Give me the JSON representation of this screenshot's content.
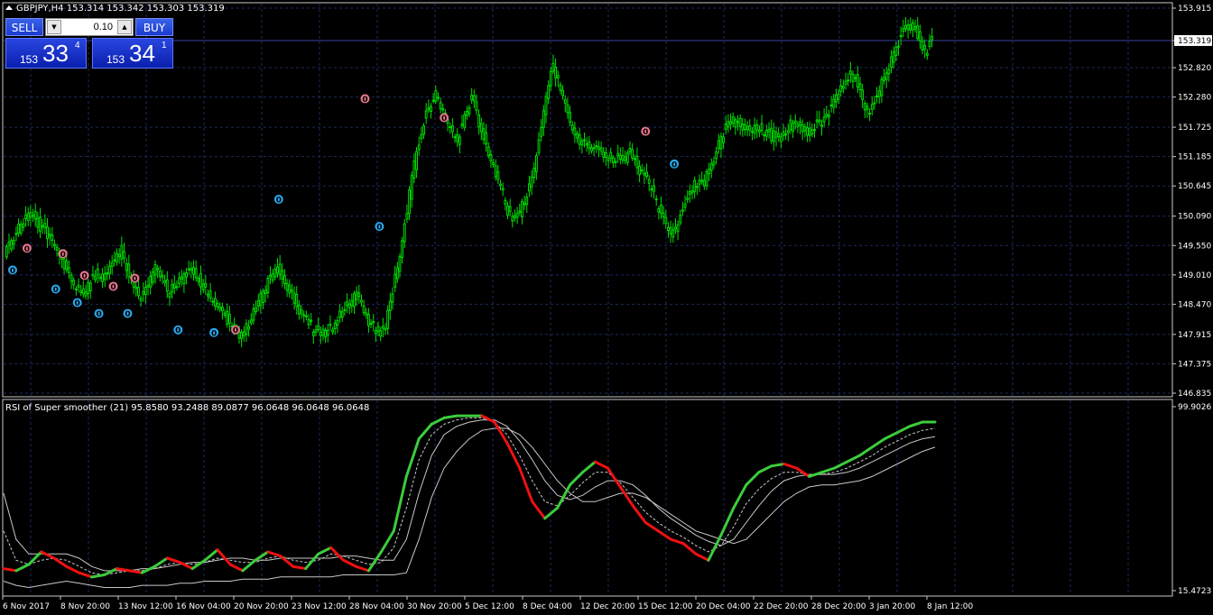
{
  "header": {
    "symbol_line": "GBPJPY,H4  153.314 153.342 153.303 153.319"
  },
  "trade_panel": {
    "sell_label": "SELL",
    "buy_label": "BUY",
    "lot_value": "0.10",
    "sell_price": {
      "prefix": "153",
      "big": "33",
      "sup": "4"
    },
    "buy_price": {
      "prefix": "153",
      "big": "34",
      "sup": "1"
    }
  },
  "indicator": {
    "label": "RSI of Super smoother (21) 95.8580 93.2488 89.0877 96.0648 96.0648 96.0648"
  },
  "price_axis": {
    "ticks": [
      "153.915",
      "153.319",
      "152.820",
      "152.280",
      "151.725",
      "151.185",
      "150.645",
      "150.090",
      "149.550",
      "149.010",
      "148.470",
      "147.915",
      "147.375",
      "146.835"
    ],
    "current_price": "153.319"
  },
  "indicator_axis": {
    "top": "99.9026",
    "bottom": "15.4723"
  },
  "time_axis": {
    "ticks": [
      "6 Nov 2017",
      "8 Nov 20:00",
      "13 Nov 12:00",
      "16 Nov 04:00",
      "20 Nov 20:00",
      "23 Nov 12:00",
      "28 Nov 04:00",
      "30 Nov 20:00",
      "5 Dec 12:00",
      "8 Dec 04:00",
      "12 Dec 20:00",
      "15 Dec 12:00",
      "20 Dec 04:00",
      "22 Dec 20:00",
      "28 Dec 20:00",
      "3 Jan 20:00",
      "8 Jan 12:00"
    ]
  },
  "colors": {
    "background": "#000000",
    "candles": "#00e000",
    "grid": "#1d2a5e",
    "axis_text": "#ffffff",
    "current_price_line": "#3a3fa0",
    "rsi_up": "#3ccc3c",
    "rsi_down": "#ee1111",
    "band": "#c8c8c8",
    "marker_sell": "#e8768a",
    "marker_buy": "#2aa8ee"
  },
  "chart_data": [
    {
      "type": "candlestick",
      "title": "GBPJPY,H4",
      "ylim": [
        146.835,
        153.915
      ],
      "close_path": [
        149.45,
        149.65,
        149.85,
        150.0,
        150.1,
        149.9,
        149.75,
        149.55,
        149.3,
        149.0,
        148.75,
        148.65,
        148.9,
        149.05,
        148.95,
        149.2,
        149.45,
        149.1,
        148.8,
        148.55,
        148.8,
        149.2,
        148.9,
        148.7,
        148.85,
        149.0,
        149.1,
        148.95,
        148.7,
        148.55,
        148.4,
        148.2,
        148.0,
        147.9,
        148.1,
        148.4,
        148.7,
        148.95,
        149.1,
        148.9,
        148.65,
        148.4,
        148.2,
        148.0,
        147.95,
        148.0,
        148.15,
        148.3,
        148.5,
        148.6,
        148.35,
        148.1,
        147.95,
        148.05,
        148.7,
        149.4,
        150.2,
        151.0,
        151.7,
        152.1,
        152.3,
        152.0,
        151.7,
        151.5,
        151.95,
        152.3,
        151.8,
        151.4,
        151.0,
        150.6,
        150.2,
        150.05,
        150.25,
        150.6,
        151.2,
        152.0,
        152.8,
        152.6,
        152.1,
        151.7,
        151.5,
        151.35,
        151.4,
        151.3,
        151.2,
        151.15,
        151.1,
        151.3,
        151.0,
        150.8,
        150.6,
        150.2,
        149.9,
        149.75,
        150.1,
        150.45,
        150.7,
        150.65,
        150.95,
        151.3,
        151.6,
        151.85,
        151.8,
        151.75,
        151.7,
        151.7,
        151.65,
        151.55,
        151.5,
        151.7,
        151.85,
        151.75,
        151.65,
        151.75,
        151.85,
        152.1,
        152.35,
        152.55,
        152.7,
        152.4,
        152.0,
        152.2,
        152.5,
        152.8,
        153.2,
        153.5,
        153.6,
        153.45,
        153.1,
        153.319
      ],
      "markers_sell": [
        [
          3,
          149.5
        ],
        [
          8,
          149.4
        ],
        [
          11,
          149.0
        ],
        [
          15,
          148.8
        ],
        [
          18,
          148.95
        ],
        [
          32,
          148.0
        ],
        [
          50,
          152.25
        ],
        [
          61,
          151.9
        ],
        [
          89,
          151.65
        ]
      ],
      "markers_buy": [
        [
          1,
          149.1
        ],
        [
          7,
          148.75
        ],
        [
          10,
          148.5
        ],
        [
          13,
          148.3
        ],
        [
          17,
          148.3
        ],
        [
          24,
          148.0
        ],
        [
          29,
          147.95
        ],
        [
          38,
          150.4
        ],
        [
          52,
          149.9
        ],
        [
          93,
          151.05
        ]
      ]
    },
    {
      "type": "line",
      "title": "RSI of Super smoother (21)",
      "ylim": [
        15.4723,
        99.9026
      ],
      "series": [
        {
          "values": [
            26,
            25,
            28,
            34,
            31,
            27,
            24,
            22,
            23,
            26,
            25,
            24,
            27,
            31,
            29,
            26,
            30,
            35,
            28,
            25,
            30,
            34,
            32,
            27,
            26,
            33,
            36,
            30,
            27,
            25,
            34,
            44,
            70,
            88,
            95,
            98,
            99,
            99,
            99,
            96,
            86,
            74,
            58,
            50,
            55,
            66,
            72,
            77,
            74,
            65,
            56,
            48,
            44,
            40,
            38,
            33,
            30,
            42,
            55,
            66,
            72,
            75,
            76,
            74,
            70,
            72,
            74,
            77,
            80,
            84,
            88,
            91,
            94,
            96,
            96
          ]
        },
        {
          "values": [
            44,
            30,
            28,
            30,
            31,
            30,
            27,
            24,
            23,
            24,
            25,
            25,
            26,
            28,
            29,
            28,
            29,
            31,
            30,
            29,
            29,
            31,
            32,
            30,
            29,
            30,
            33,
            32,
            30,
            28,
            29,
            36,
            55,
            78,
            90,
            95,
            97,
            98,
            98,
            96,
            90,
            80,
            68,
            58,
            56,
            61,
            67,
            72,
            72,
            67,
            60,
            53,
            48,
            44,
            41,
            37,
            34,
            37,
            46,
            57,
            64,
            69,
            72,
            72,
            71,
            71,
            72,
            74,
            77,
            80,
            84,
            87,
            90,
            92,
            93
          ]
        },
        {
          "values": [
            62,
            40,
            33,
            33,
            33,
            33,
            31,
            27,
            25,
            25,
            25,
            26,
            26,
            27,
            28,
            29,
            29,
            30,
            31,
            31,
            30,
            30,
            31,
            31,
            31,
            31,
            31,
            32,
            32,
            31,
            30,
            30,
            40,
            62,
            80,
            90,
            94,
            96,
            97,
            97,
            94,
            87,
            78,
            68,
            61,
            59,
            61,
            65,
            68,
            68,
            66,
            61,
            55,
            50,
            46,
            42,
            39,
            37,
            40,
            48,
            56,
            63,
            68,
            70,
            71,
            71,
            71,
            72,
            74,
            77,
            80,
            83,
            86,
            88,
            89
          ]
        },
        {
          "values": [
            20,
            18,
            17,
            18,
            19,
            20,
            19,
            18,
            17,
            17,
            17,
            18,
            18,
            18,
            19,
            19,
            20,
            20,
            20,
            21,
            21,
            21,
            22,
            22,
            22,
            22,
            22,
            23,
            23,
            23,
            23,
            23,
            24,
            40,
            60,
            74,
            82,
            88,
            92,
            93,
            93,
            90,
            84,
            76,
            68,
            62,
            58,
            58,
            60,
            62,
            62,
            60,
            56,
            52,
            48,
            44,
            42,
            40,
            38,
            40,
            46,
            52,
            58,
            62,
            65,
            66,
            66,
            67,
            68,
            70,
            73,
            76,
            79,
            82,
            84
          ]
        }
      ]
    }
  ]
}
